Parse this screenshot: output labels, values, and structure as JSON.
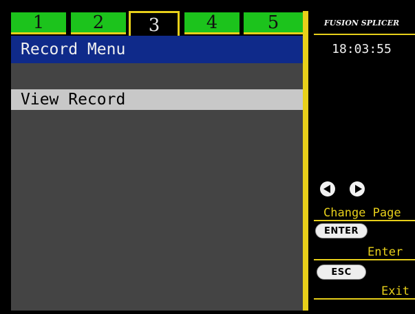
{
  "tabs": [
    "1",
    "2",
    "3",
    "4",
    "5"
  ],
  "active_tab": "3",
  "title": "Record Menu",
  "menu": {
    "items": [
      {
        "label": "View Record"
      }
    ]
  },
  "side_panel": {
    "brand": "FUSION SPLICER",
    "clock": "18:03:55",
    "change_page": "Change Page",
    "enter_key": "ENTER",
    "enter_label": "Enter",
    "esc_key": "ESC",
    "exit_label": "Exit"
  },
  "colors": {
    "tab_green": "#1cc31c",
    "accent_yellow": "#e8d01a",
    "title_blue": "#0f2a8a",
    "panel_gray": "#444444",
    "selected_gray": "#c8c8c8"
  }
}
